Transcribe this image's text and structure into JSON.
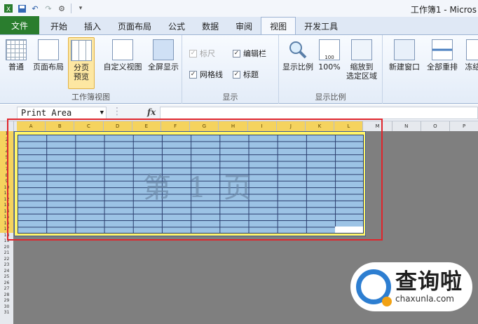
{
  "window": {
    "title": "工作簿1 - Micros"
  },
  "qat": [
    "save-icon",
    "undo-icon",
    "redo-icon",
    "customize-icon"
  ],
  "tabs": [
    "文件",
    "开始",
    "插入",
    "页面布局",
    "公式",
    "数据",
    "审阅",
    "视图",
    "开发工具"
  ],
  "active_tab": "视图",
  "ribbon": {
    "workbook_views": {
      "label": "工作簿视图",
      "buttons": [
        "普通",
        "页面布局",
        "分页\n预览",
        "自定义视图",
        "全屏显示"
      ],
      "selected": "分页\n预览"
    },
    "show": {
      "label": "显示",
      "checks": [
        {
          "text": "标尺",
          "checked": true,
          "enabled": false
        },
        {
          "text": "编辑栏",
          "checked": true,
          "enabled": true
        },
        {
          "text": "网格线",
          "checked": true,
          "enabled": true
        },
        {
          "text": "标题",
          "checked": true,
          "enabled": true
        }
      ]
    },
    "zoom": {
      "label": "显示比例",
      "buttons": [
        "显示比例",
        "100%",
        "缩放到\n选定区域"
      ]
    },
    "window": {
      "buttons": [
        "新建窗口",
        "全部重排",
        "冻结窗"
      ]
    }
  },
  "formula_bar": {
    "name_box": "Print Area",
    "fx": "fx",
    "content": ""
  },
  "sheet": {
    "columns": [
      "A",
      "B",
      "C",
      "D",
      "E",
      "F",
      "G",
      "H",
      "I",
      "J",
      "K",
      "L",
      "M",
      "N",
      "O",
      "P"
    ],
    "rows": [
      "1",
      "2",
      "3",
      "4",
      "5",
      "6",
      "7",
      "8",
      "9",
      "10",
      "11",
      "12",
      "13",
      "14",
      "15",
      "16",
      "17",
      "18",
      "19",
      "20",
      "21",
      "22",
      "23",
      "24",
      "25",
      "26",
      "27",
      "28",
      "29",
      "30",
      "31"
    ],
    "page_label": "第 1 页"
  },
  "logo": {
    "cn": "查询啦",
    "en": "chaxunla.com"
  }
}
